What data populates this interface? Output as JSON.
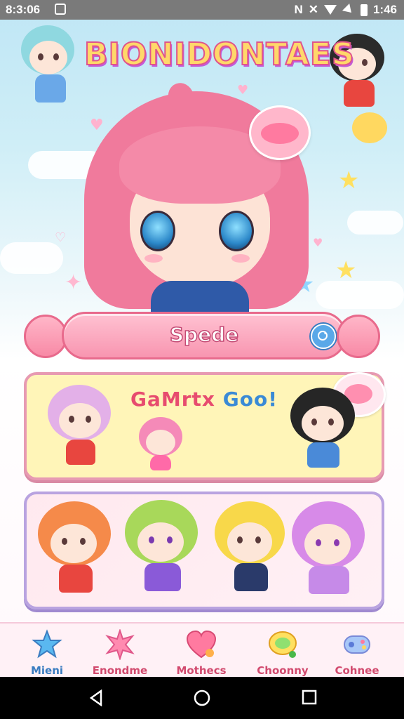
{
  "status_bar": {
    "time": "8:3:06",
    "right_text": "1:46",
    "icons": [
      "gallery-icon",
      "mute-icon",
      "nfc-icon",
      "wifi-icon",
      "signal-icon",
      "battery-icon"
    ]
  },
  "app": {
    "title": "BIONIDONTAES"
  },
  "search": {
    "label": "Spede",
    "button_icon": "refresh-icon"
  },
  "cards": {
    "featured_title_part1": "GaMrtx",
    "featured_title_part2": "Goo!"
  },
  "bottom_nav": {
    "items": [
      {
        "label": "Mieni",
        "icon": "star-icon"
      },
      {
        "label": "Enondme",
        "icon": "sparkle-icon"
      },
      {
        "label": "Mothecs",
        "icon": "heart-icon"
      },
      {
        "label": "Choonny",
        "icon": "chat-icon"
      },
      {
        "label": "Cohnee",
        "icon": "gamepad-icon"
      }
    ]
  },
  "colors": {
    "primary_pink": "#f895b0",
    "accent_blue": "#3a7cc0",
    "card_yellow": "#fff5b8",
    "card_purple_border": "#b9a3e0"
  }
}
